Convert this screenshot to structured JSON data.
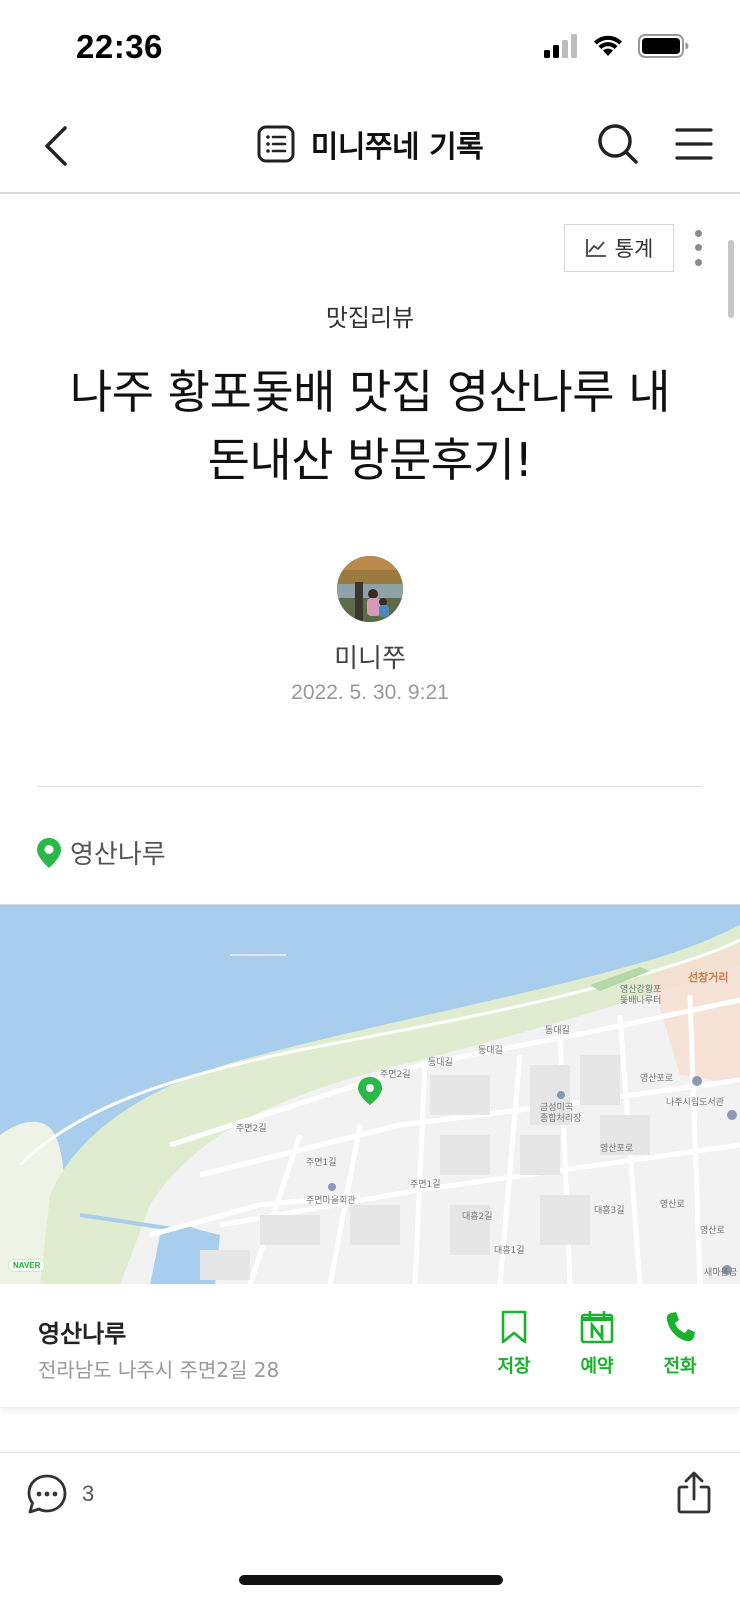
{
  "status_bar": {
    "time": "22:36"
  },
  "nav": {
    "title": "미니쭈네 기록",
    "icons": [
      "back-icon",
      "list-icon",
      "search-icon",
      "menu-icon"
    ]
  },
  "toolbar": {
    "stats_label": "통계"
  },
  "post": {
    "category": "맛집리뷰",
    "title_line1": "나주 황포돛배 맛집 영산나루 내",
    "title_line2": "돈내산 방문후기!",
    "author": "미니쭈",
    "date": "2022. 5. 30. 9:21"
  },
  "place": {
    "name": "영산나루",
    "address": "전라남도 나주시 주면2길 28",
    "pin_color": "#2bb84a"
  },
  "map": {
    "logo": "NAVER",
    "labels": {
      "ferry": "영산강황포\n돛배나루터",
      "seonchang": "선창거리",
      "library": "나주시립도서관",
      "yeongsanporo": "영산포로",
      "yeongsanporo2": "영산포로",
      "dongdae": "동대길",
      "dongdae2": "동대길",
      "dongdae3": "동대길",
      "jumyeon2": "주면2길",
      "jumyeon2b": "주면2길",
      "jumyeon1": "주면1길",
      "jumyeon1b": "주면1길",
      "hall": "주면마을회관",
      "geumseong": "금성미곡\n종합처리장",
      "daeheung": "대흥2길",
      "daeheung2": "대흥1길",
      "dongdae4": "대흥3길",
      "saemaeul": "새마을금",
      "yeongsan_road": "영산로",
      "yeongsan_road2": "영산로"
    }
  },
  "actions": {
    "save": "저장",
    "reserve": "예약",
    "call": "전화"
  },
  "bottom_bar": {
    "comment_count": "3"
  },
  "colors": {
    "accent_green": "#19b22c",
    "water": "#a9cdec",
    "land": "#f2f2f2",
    "park": "#dfeccf"
  }
}
